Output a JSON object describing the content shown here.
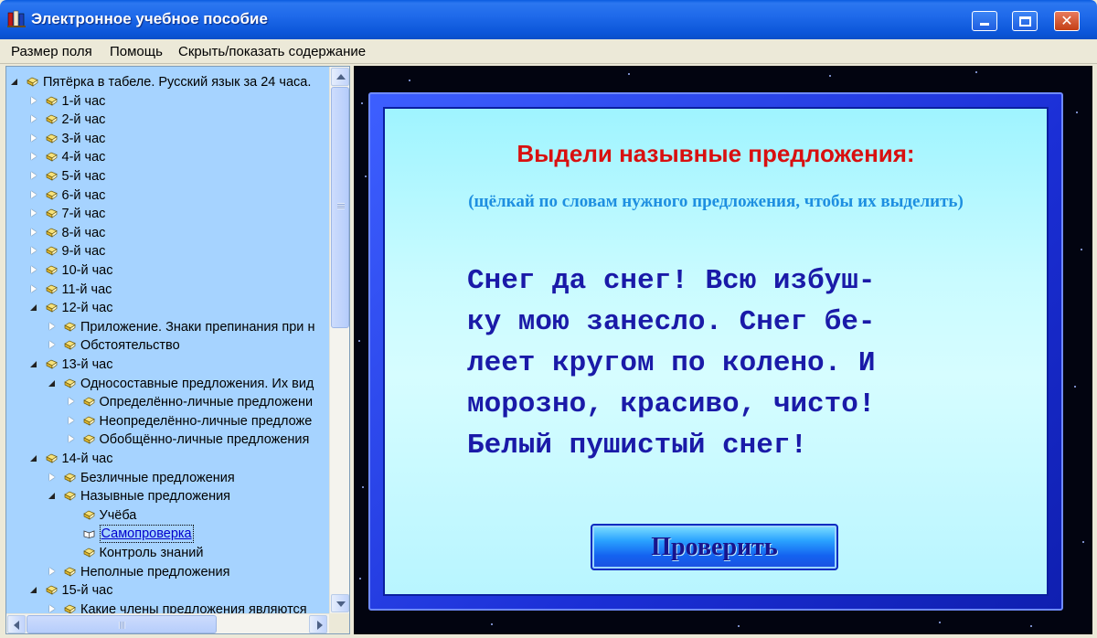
{
  "window": {
    "title": "Электронное учебное пособие",
    "app_icon": "books-icon",
    "controls": [
      "minimize-icon",
      "maximize-icon",
      "close-icon"
    ]
  },
  "menu": {
    "items": [
      "Размер поля",
      "Помощь",
      "Скрыть/показать содержание"
    ]
  },
  "tree": {
    "items": [
      {
        "label": "Пятёрка в табеле. Русский язык за 24 часа.",
        "level": 0,
        "expander": "open",
        "icon": "closed-book-icon"
      },
      {
        "label": "1-й час",
        "level": 1,
        "expander": "closed",
        "icon": "closed-book-icon"
      },
      {
        "label": "2-й час",
        "level": 1,
        "expander": "closed",
        "icon": "closed-book-icon"
      },
      {
        "label": "3-й час",
        "level": 1,
        "expander": "closed",
        "icon": "closed-book-icon"
      },
      {
        "label": "4-й час",
        "level": 1,
        "expander": "closed",
        "icon": "closed-book-icon"
      },
      {
        "label": "5-й час",
        "level": 1,
        "expander": "closed",
        "icon": "closed-book-icon"
      },
      {
        "label": "6-й час",
        "level": 1,
        "expander": "closed",
        "icon": "closed-book-icon"
      },
      {
        "label": "7-й час",
        "level": 1,
        "expander": "closed",
        "icon": "closed-book-icon"
      },
      {
        "label": "8-й час",
        "level": 1,
        "expander": "closed",
        "icon": "closed-book-icon"
      },
      {
        "label": "9-й час",
        "level": 1,
        "expander": "closed",
        "icon": "closed-book-icon"
      },
      {
        "label": "10-й час",
        "level": 1,
        "expander": "closed",
        "icon": "closed-book-icon"
      },
      {
        "label": "11-й час",
        "level": 1,
        "expander": "closed",
        "icon": "closed-book-icon"
      },
      {
        "label": "12-й час",
        "level": 1,
        "expander": "open",
        "icon": "closed-book-icon"
      },
      {
        "label": "Приложение. Знаки препинания при н",
        "level": 2,
        "expander": "closed",
        "icon": "closed-book-icon"
      },
      {
        "label": "Обстоятельство",
        "level": 2,
        "expander": "closed",
        "icon": "closed-book-icon"
      },
      {
        "label": "13-й час",
        "level": 1,
        "expander": "open",
        "icon": "closed-book-icon"
      },
      {
        "label": "Односоставные предложения. Их вид",
        "level": 2,
        "expander": "open",
        "icon": "closed-book-icon"
      },
      {
        "label": "Определённо-личные предложени",
        "level": 3,
        "expander": "closed",
        "icon": "closed-book-icon"
      },
      {
        "label": "Неопределённо-личные предложе",
        "level": 3,
        "expander": "closed",
        "icon": "closed-book-icon"
      },
      {
        "label": "Обобщённо-личные предложения",
        "level": 3,
        "expander": "closed",
        "icon": "closed-book-icon"
      },
      {
        "label": "14-й час",
        "level": 1,
        "expander": "open",
        "icon": "closed-book-icon"
      },
      {
        "label": "Безличные предложения",
        "level": 2,
        "expander": "closed",
        "icon": "closed-book-icon"
      },
      {
        "label": "Назывные предложения",
        "level": 2,
        "expander": "open",
        "icon": "closed-book-icon"
      },
      {
        "label": "Учёба",
        "level": 3,
        "expander": "none",
        "icon": "closed-book-icon"
      },
      {
        "label": "Самопроверка",
        "level": 3,
        "expander": "none",
        "icon": "open-book-icon",
        "selected": true
      },
      {
        "label": "Контроль знаний",
        "level": 3,
        "expander": "none",
        "icon": "closed-book-icon"
      },
      {
        "label": "Неполные предложения",
        "level": 2,
        "expander": "closed",
        "icon": "closed-book-icon"
      },
      {
        "label": "15-й час",
        "level": 1,
        "expander": "open",
        "icon": "closed-book-icon"
      },
      {
        "label": "Какие члены предложения являются",
        "level": 2,
        "expander": "closed",
        "icon": "closed-book-icon"
      }
    ]
  },
  "exercise": {
    "title": "Выдели назывные предложения:",
    "hint": "(щёлкай по словам нужного предложения, чтобы их выделить)",
    "passage_lines": [
      "Снег да снег! Всю избуш-",
      "ку мою занесло. Снег бе-",
      "леет кругом по колено. И",
      "морозно, красиво, чисто!",
      "Белый пушистый снег!"
    ],
    "check_button": "Проверить"
  },
  "colors": {
    "title_red": "#d81010",
    "hint_blue": "#1e8fe0",
    "passage_blue": "#1a1aa8",
    "tree_bg": "#a6d3ff"
  }
}
